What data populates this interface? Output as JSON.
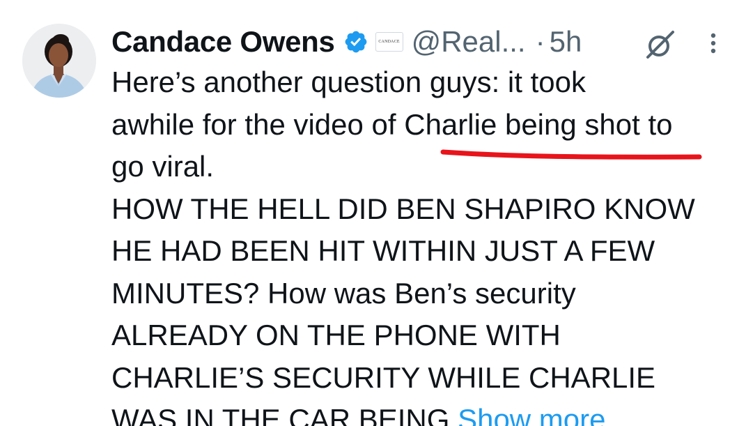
{
  "author": {
    "name": "Candace Owens",
    "affiliate_badge": "CANDACE",
    "handle": "@Real...",
    "separator": "·",
    "time": "5h"
  },
  "icons": {
    "verified": "verified-badge-icon",
    "grok": "grok-icon",
    "more": "more-options-icon"
  },
  "colors": {
    "verified_blue": "#1d9bf0",
    "link_blue": "#1d9bf0",
    "secondary_text": "#536471",
    "annotation_red": "#e8141b"
  },
  "tweet": {
    "lines": [
      "Here’s another question guys: it took",
      "awhile for the video of Charlie being shot to",
      "go viral.",
      "HOW THE HELL DID BEN SHAPIRO KNOW",
      "HE HAD BEEN HIT WITHIN JUST A FEW",
      "MINUTES? How was Ben’s security",
      "ALREADY ON THE PHONE WITH",
      "CHARLIE’S SECURITY WHILE CHARLIE",
      "WAS IN THE CAR BEING"
    ],
    "show_more": "Show more"
  }
}
